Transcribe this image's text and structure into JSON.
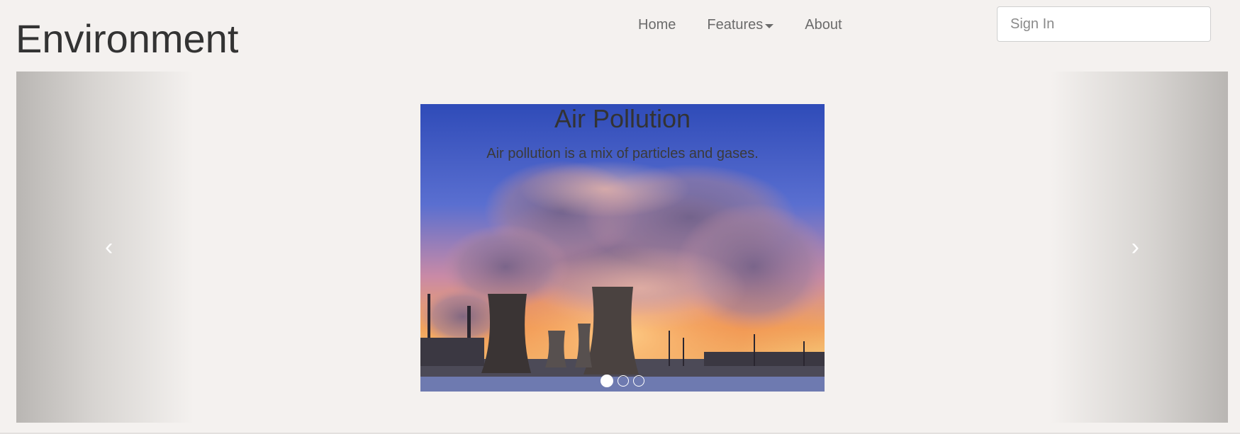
{
  "brand": {
    "title": "Environment"
  },
  "nav": {
    "items": [
      {
        "label": "Home"
      },
      {
        "label": "Features",
        "has_dropdown": true
      },
      {
        "label": "About"
      }
    ]
  },
  "signin": {
    "placeholder": "Sign In",
    "value": ""
  },
  "carousel": {
    "prev_glyph": "‹",
    "next_glyph": "›",
    "slide": {
      "title": "Air Pollution",
      "text": "Air pollution is a mix of particles and gases.",
      "image": "factory-cooling-towers-smoke-sunset"
    },
    "indicators": {
      "count": 3,
      "active_index": 0
    }
  },
  "colors": {
    "background": "#f4f1ef",
    "sky_top": "#3a53b8",
    "smoke_glow": "#f28b4a"
  }
}
